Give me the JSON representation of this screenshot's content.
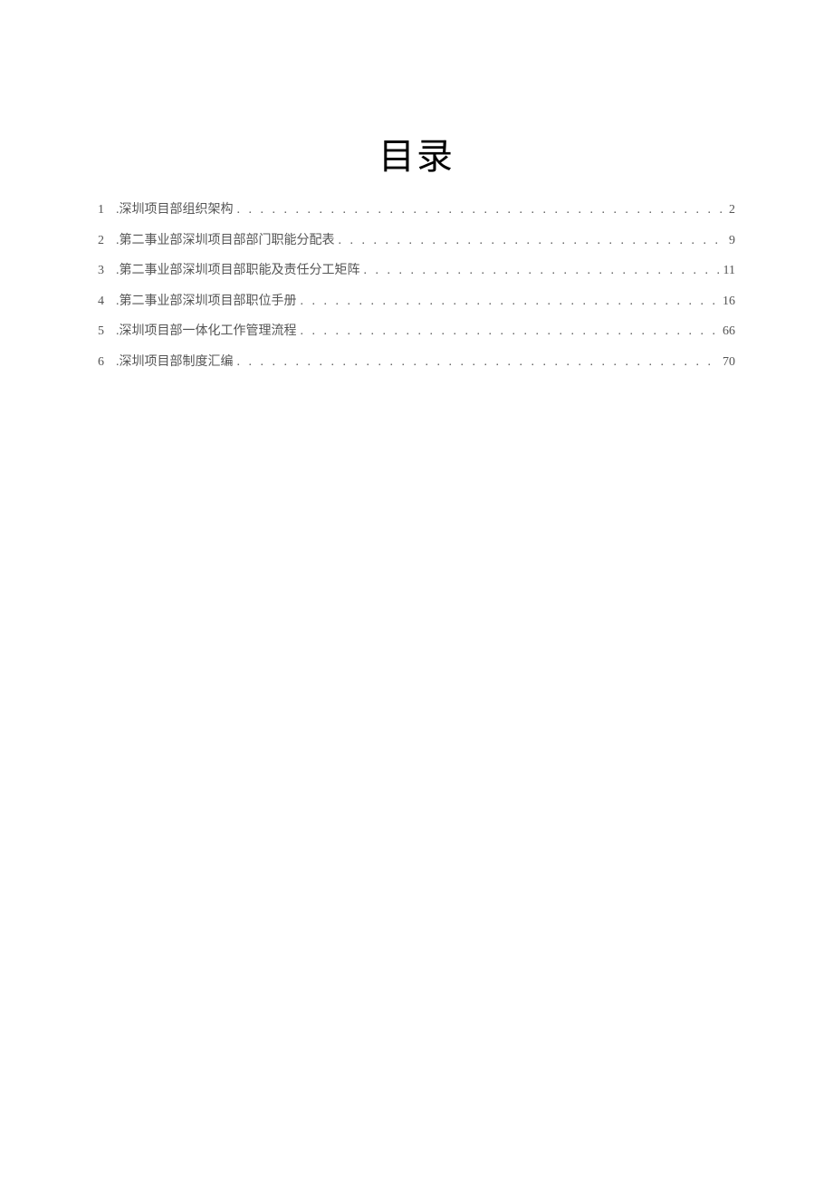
{
  "title": "目录",
  "toc": [
    {
      "num": "1",
      "label": ".深圳项目部组织架构",
      "page": "2"
    },
    {
      "num": "2",
      "label": ".第二事业部深圳项目部部门职能分配表",
      "page": "9"
    },
    {
      "num": "3",
      "label": ".第二事业部深圳项目部职能及责任分工矩阵",
      "page": "11"
    },
    {
      "num": "4",
      "label": ".第二事业部深圳项目部职位手册",
      "page": "16"
    },
    {
      "num": "5",
      "label": ".深圳项目部一体化工作管理流程",
      "page": "66"
    },
    {
      "num": "6",
      "label": ".深圳项目部制度汇编",
      "page": "70"
    }
  ]
}
